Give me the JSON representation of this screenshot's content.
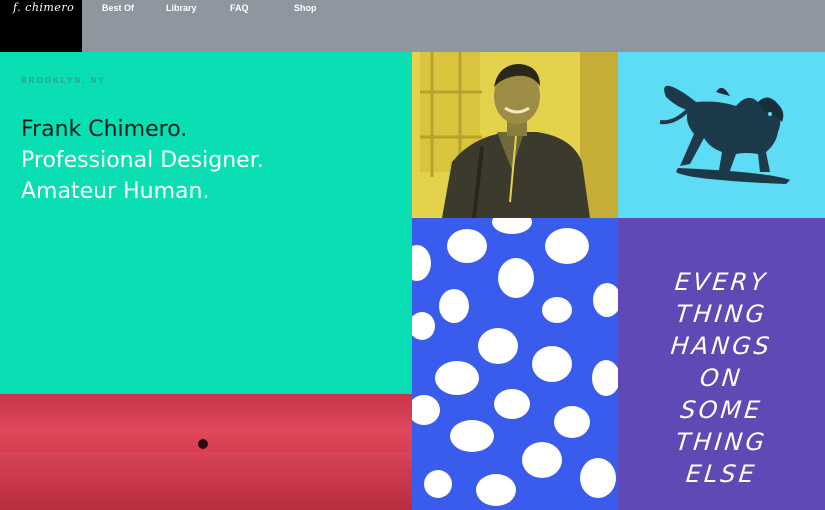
{
  "header": {
    "logo": "f. chimero",
    "nav": [
      "Best Of",
      "Library",
      "FAQ",
      "Shop"
    ]
  },
  "intro": {
    "location": "BROOKLYN, NY",
    "name": "Frank Chimero.",
    "tagline_1": "Professional Designer.",
    "tagline_2": "Amateur Human."
  },
  "quote": {
    "lines": [
      "EVERY",
      "THING",
      "HANGS",
      "ON",
      "SOME",
      "THING",
      "ELSE"
    ]
  },
  "colors": {
    "topbar": "#8e969f",
    "intro": "#09dfb2",
    "portrait": "#e5d24c",
    "sculpture": "#5fdcf5",
    "dots": "#3a5ced",
    "quote": "#6048b5",
    "sunset": "#d63a4e"
  }
}
